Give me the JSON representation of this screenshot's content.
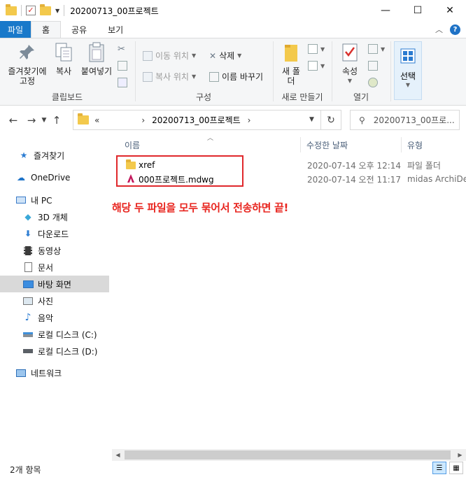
{
  "window": {
    "title": "20200713_00프로젝트",
    "controls": {
      "minimize": "—",
      "maximize": "☐",
      "close": "✕"
    }
  },
  "ribbon_tabs": [
    {
      "label": "파일"
    },
    {
      "label": "홈"
    },
    {
      "label": "공유"
    },
    {
      "label": "보기"
    }
  ],
  "ribbon": {
    "clipboard": {
      "pin": "즐겨찾기에 고정",
      "copy": "복사",
      "paste": "붙여넣기",
      "group": "클립보드"
    },
    "organize": {
      "move_to": "이동 위치",
      "copy_to": "복사 위치",
      "delete": "삭제",
      "rename": "이름 바꾸기",
      "group": "구성"
    },
    "new": {
      "new_folder": "새 폴더",
      "group": "새로 만들기"
    },
    "open": {
      "properties": "속성",
      "group": "열기"
    },
    "select": {
      "label": "선택"
    }
  },
  "address": {
    "prefix": "«",
    "path": "20200713_00프로젝트",
    "separator": "›"
  },
  "search": {
    "placeholder": "20200713_00프로..."
  },
  "nav_pane": [
    {
      "label": "즐겨찾기",
      "icon": "star-icon"
    },
    {
      "label": "OneDrive",
      "icon": "cloud-icon"
    },
    {
      "label": "내 PC",
      "icon": "pc-icon"
    },
    {
      "label": "3D 개체",
      "icon": "cube-icon"
    },
    {
      "label": "다운로드",
      "icon": "download-icon"
    },
    {
      "label": "동영상",
      "icon": "film-icon"
    },
    {
      "label": "문서",
      "icon": "document-icon"
    },
    {
      "label": "바탕 화면",
      "icon": "desktop-icon"
    },
    {
      "label": "사진",
      "icon": "picture-icon"
    },
    {
      "label": "음악",
      "icon": "music-icon"
    },
    {
      "label": "로컬 디스크 (C:)",
      "icon": "drive-icon"
    },
    {
      "label": "로컬 디스크 (D:)",
      "icon": "drive-icon"
    },
    {
      "label": "네트워크",
      "icon": "network-icon"
    }
  ],
  "columns": {
    "name": "이름",
    "modified": "수정한 날짜",
    "type": "유형"
  },
  "files": [
    {
      "name": "xref",
      "modified": "2020-07-14 오후 12:14",
      "type": "파일 폴더",
      "icon": "folder-icon"
    },
    {
      "name": "000프로젝트.mdwg",
      "modified": "2020-07-14 오전 11:17",
      "type": "midas ArchiDesign",
      "icon": "mdwg-file-icon"
    }
  ],
  "annotation": "해당 두 파일을 모두 묶어서 전송하면 끝!",
  "status": {
    "count": "2개 항목"
  },
  "colors": {
    "accent": "#1979ca",
    "annotation_red": "#e8251f",
    "folder_yellow": "#f3c94c"
  }
}
